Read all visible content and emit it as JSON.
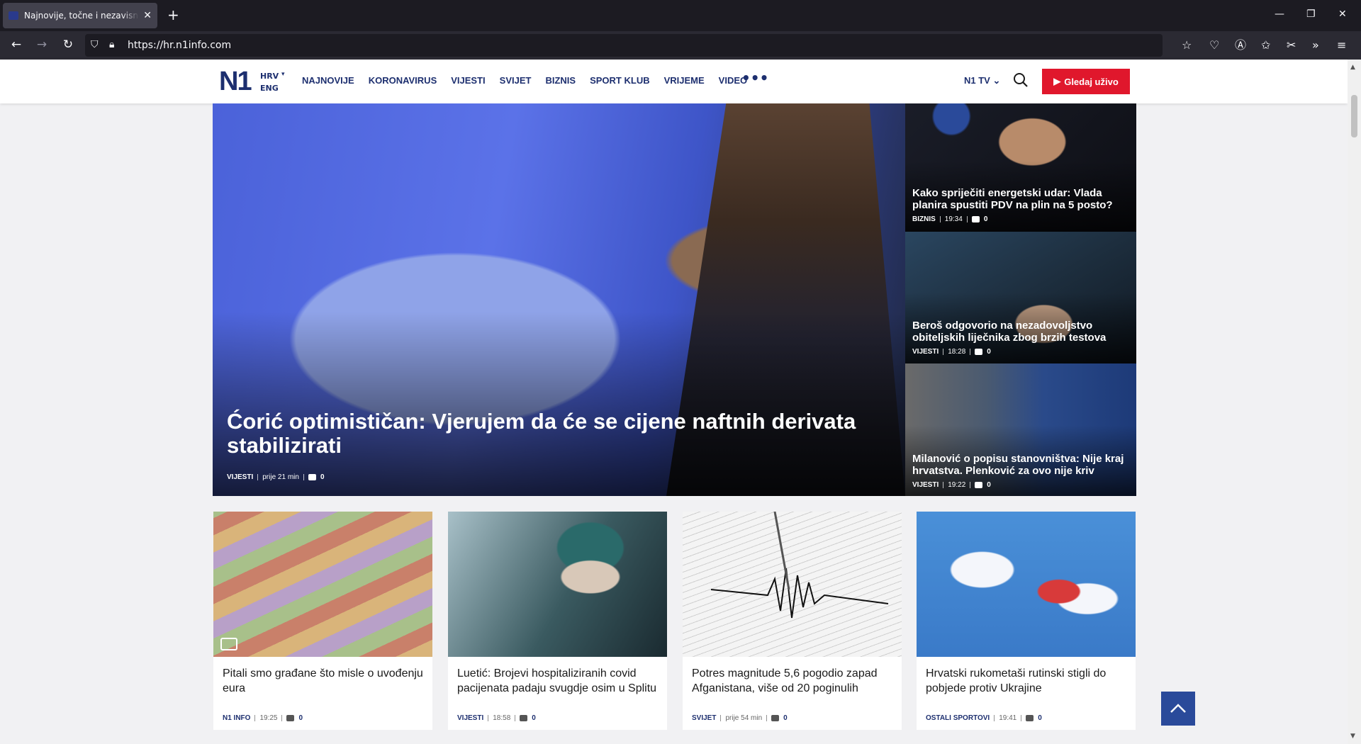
{
  "browser": {
    "tab_title": "Najnovije, točne i nezavisne vijesti",
    "tab_close": "✕",
    "new_tab": "+",
    "url": "https://hr.n1info.com",
    "window_controls": [
      "—",
      "❐",
      "✕"
    ]
  },
  "site": {
    "logo": "N1",
    "lang_primary": "HRV",
    "lang_secondary": "ENG",
    "menu": [
      "NAJNOVIJE",
      "KORONAVIRUS",
      "VIJESTI",
      "SVIJET",
      "BIZNIS",
      "SPORT KLUB",
      "VRIJEME",
      "VIDEO"
    ],
    "more": "•••",
    "n1tv": "N1 TV",
    "live_button": "Gledaj uživo"
  },
  "hero": {
    "title": "Ćorić optimističan: Vjerujem da će se cijene naftnih derivata stabilizirati",
    "category": "VIJESTI",
    "time": "prije 21 min",
    "comments": "0"
  },
  "side_stories": [
    {
      "title": "Kako spriječiti energetski udar: Vlada planira spustiti PDV na plin na 5 posto?",
      "category": "BIZNIS",
      "time": "19:34",
      "comments": "0"
    },
    {
      "title": "Beroš odgovorio na nezadovoljstvo obiteljskih liječnika zbog brzih testova",
      "category": "VIJESTI",
      "time": "18:28",
      "comments": "0"
    },
    {
      "title": "Milanović o popisu stanovništva: Nije kraj hrvatstva. Plenković za ovo nije kriv",
      "category": "VIJESTI",
      "time": "19:22",
      "comments": "0"
    }
  ],
  "cards": [
    {
      "title": "Pitali smo građane što misle o uvođenju eura",
      "category": "N1 INFO",
      "time": "19:25",
      "comments": "0"
    },
    {
      "title": "Luetić: Brojevi hospitaliziranih covid pacijenata padaju svugdje osim u Splitu",
      "category": "VIJESTI",
      "time": "18:58",
      "comments": "0"
    },
    {
      "title": "Potres magnitude 5,6 pogodio zapad Afganistana, više od 20 poginulih",
      "category": "SVIJET",
      "time": "prije 54 min",
      "comments": "0"
    },
    {
      "title": "Hrvatski rukometaši rutinski stigli do pobjede protiv Ukrajine",
      "category": "OSTALI SPORTOVI",
      "time": "19:41",
      "comments": "0"
    }
  ]
}
